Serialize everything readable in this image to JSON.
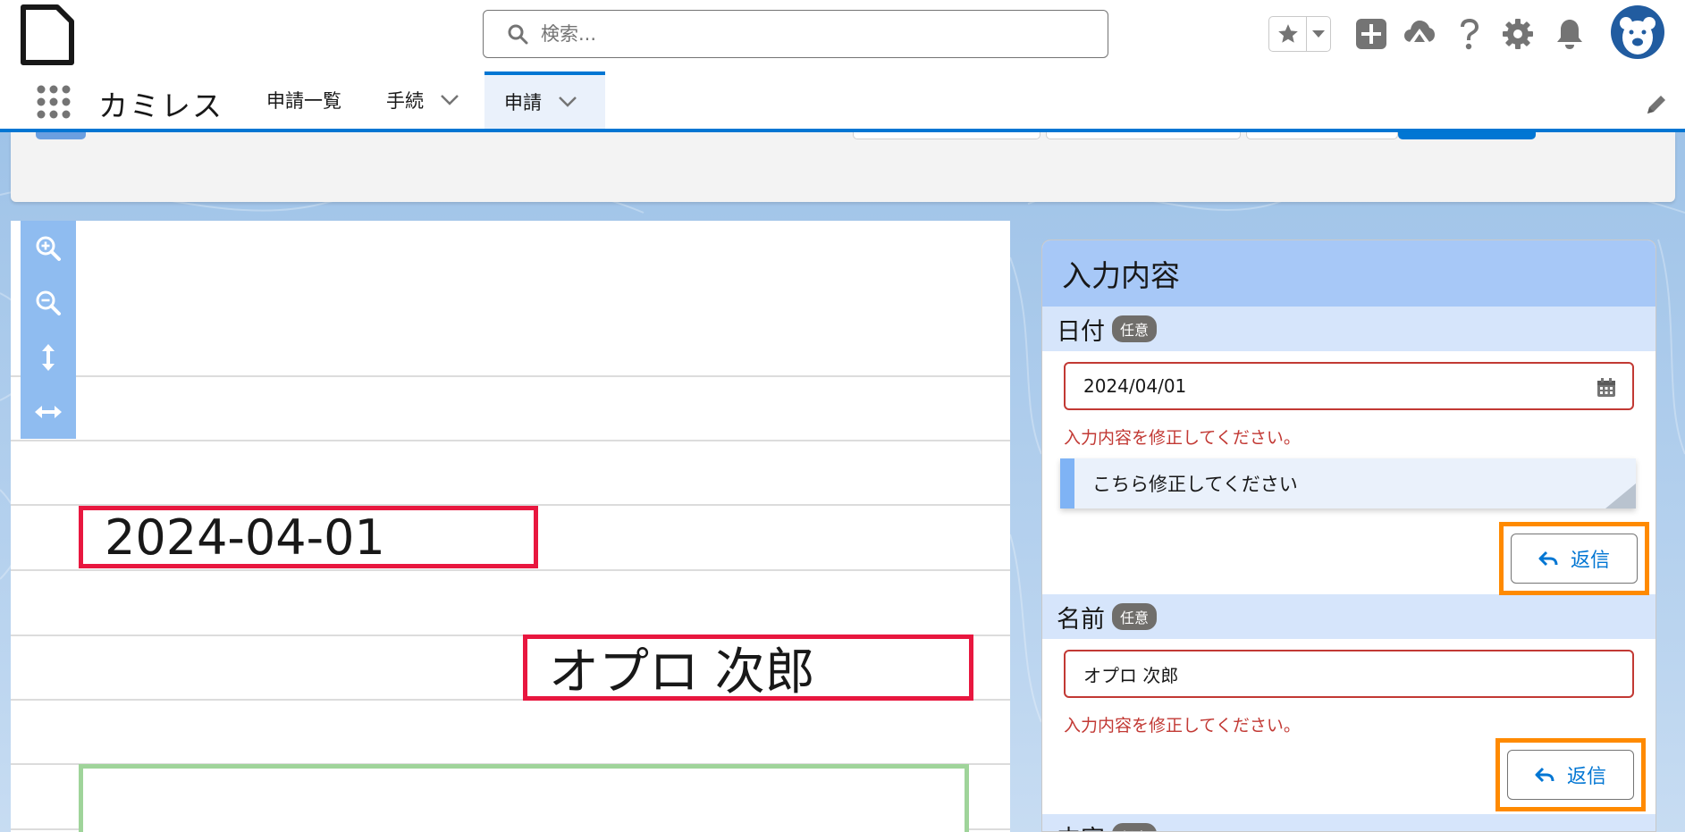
{
  "header": {
    "search": {
      "placeholder": "検索..."
    }
  },
  "nav": {
    "app_name": "カミレス",
    "tabs": [
      {
        "label": "申請一覧"
      },
      {
        "label": "手続"
      },
      {
        "label": "申請"
      }
    ]
  },
  "viewer": {
    "highlights": [
      {
        "text": "2024-04-01"
      },
      {
        "text": "オプロ 次郎"
      }
    ]
  },
  "panel": {
    "title": "入力内容",
    "fields": [
      {
        "label": "日付",
        "badge": "任意",
        "value": "2024/04/01",
        "error": "入力内容を修正してください。",
        "comment": "こちら修正してください",
        "reply_label": "返信"
      },
      {
        "label": "名前",
        "badge": "任意",
        "value": "オプロ 次郎",
        "error": "入力内容を修正してください。",
        "reply_label": "返信"
      },
      {
        "label": "内容",
        "badge": "任意"
      }
    ]
  },
  "colors": {
    "brand": "#0176d3",
    "error": "#c23934",
    "highlight_red": "#e8173f",
    "highlight_green": "#9fd49a",
    "reply_outline": "#ff8a00",
    "panel_header": "#a7c8f7"
  }
}
